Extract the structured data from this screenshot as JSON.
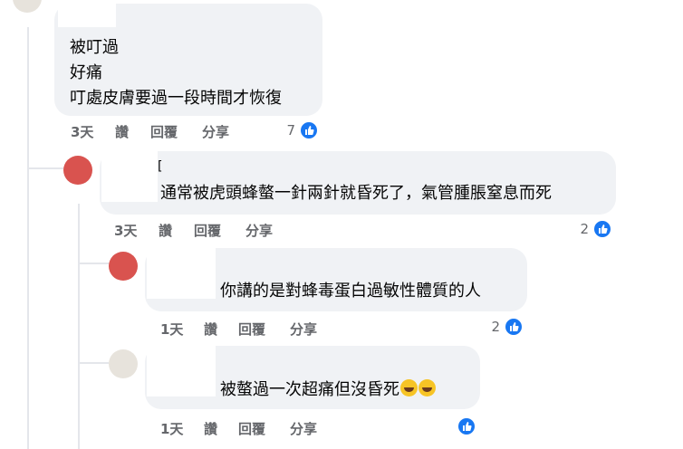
{
  "comments": [
    {
      "lines": [
        "被叮過",
        "好痛",
        "叮處皮膚要過一段時間才恢復"
      ],
      "time": "3天",
      "like": "讚",
      "reply": "回覆",
      "share": "分享",
      "reactions": "7"
    },
    {
      "author_fragment": "[",
      "text": "通常被虎頭蜂螫一針兩針就昏死了，氣管腫脹窒息而死",
      "time": "3天",
      "like": "讚",
      "reply": "回覆",
      "share": "分享",
      "reactions": "2"
    },
    {
      "text": "你講的是對蜂毒蛋白過敏性體質的人",
      "time": "1天",
      "like": "讚",
      "reply": "回覆",
      "share": "分享",
      "reactions": "2"
    },
    {
      "text": "被螫過一次超痛但沒昏死",
      "emojis": [
        "rolling-on-floor-laughing-emoji",
        "rolling-on-floor-laughing-emoji"
      ],
      "time": "1天",
      "like": "讚",
      "reply": "回覆",
      "share": "分享",
      "reactions": ""
    }
  ],
  "colors": {
    "bubble": "#f0f2f5",
    "thread_line": "#e4e6eb",
    "meta_text": "#65676b",
    "like_blue": "#1877f2"
  },
  "icons": [
    "thumbs-up-icon",
    "avatar"
  ]
}
